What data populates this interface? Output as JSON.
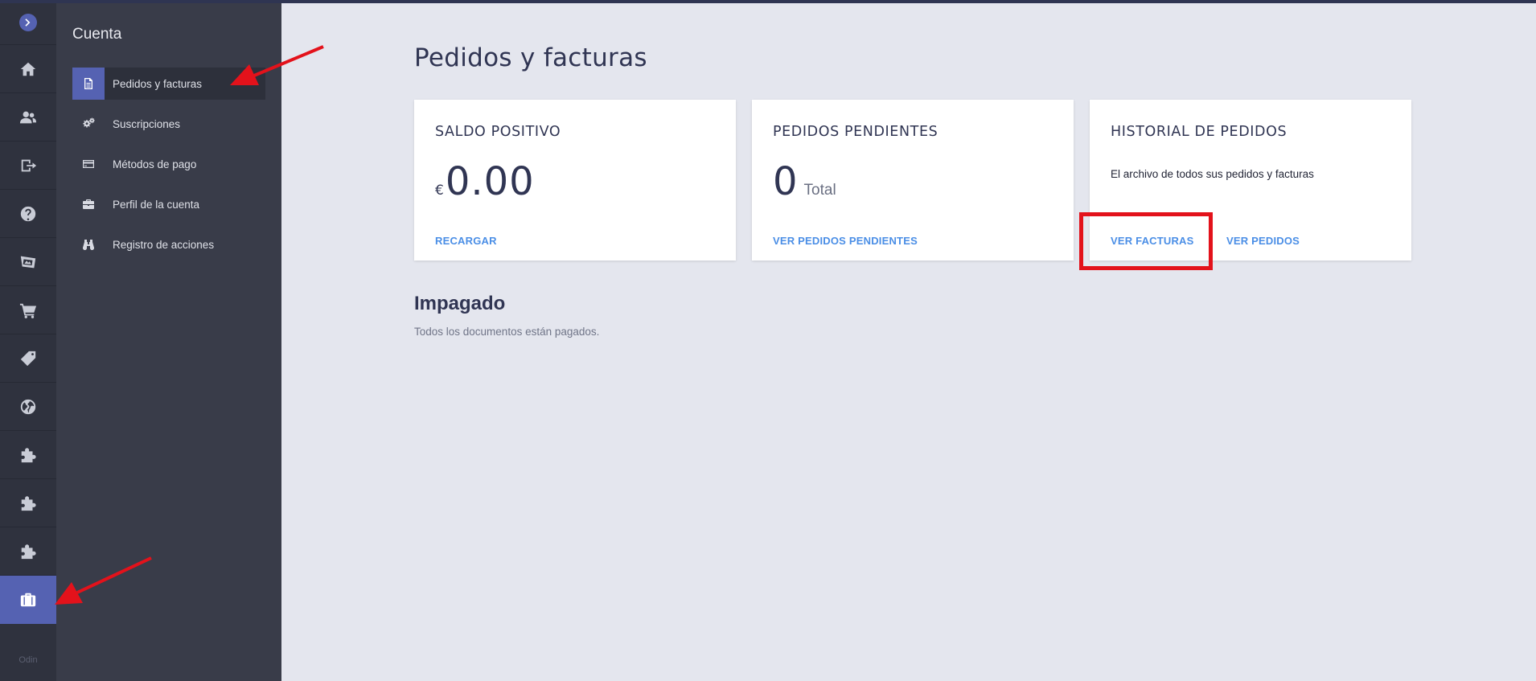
{
  "rail": {
    "brand": "Odin",
    "items": [
      "home-icon",
      "users-icon",
      "transfer-icon",
      "help-icon",
      "domains-icon",
      "cart-icon",
      "tag-icon",
      "globe-icon",
      "plugin-icon",
      "plugin-icon",
      "plugin-icon",
      "briefcase-icon"
    ]
  },
  "subnav": {
    "title": "Cuenta",
    "items": [
      {
        "label": "Pedidos y facturas",
        "icon": "document-icon",
        "active": true
      },
      {
        "label": "Suscripciones",
        "icon": "gears-icon",
        "active": false
      },
      {
        "label": "Métodos de pago",
        "icon": "credit-card-icon",
        "active": false
      },
      {
        "label": "Perfil de la cuenta",
        "icon": "briefcase-icon",
        "active": false
      },
      {
        "label": "Registro de acciones",
        "icon": "binoculars-icon",
        "active": false
      }
    ]
  },
  "main": {
    "title": "Pedidos y facturas",
    "cards": {
      "balance": {
        "title": "SALDO POSITIVO",
        "currency": "€",
        "amount": "0.00",
        "link": "RECARGAR"
      },
      "pending": {
        "title": "PEDIDOS PENDIENTES",
        "count": "0",
        "unit": "Total",
        "link": "VER PEDIDOS PENDIENTES"
      },
      "history": {
        "title": "HISTORIAL DE PEDIDOS",
        "description": "El archivo de todos sus pedidos y facturas",
        "link_invoices": "VER FACTURAS",
        "link_orders": "VER PEDIDOS"
      }
    },
    "unpaid": {
      "title": "Impagado",
      "text": "Todos los documentos están pagados."
    }
  },
  "colors": {
    "accent": "#5562b2",
    "link": "#4a8ee6",
    "annotation": "#e3121b"
  }
}
